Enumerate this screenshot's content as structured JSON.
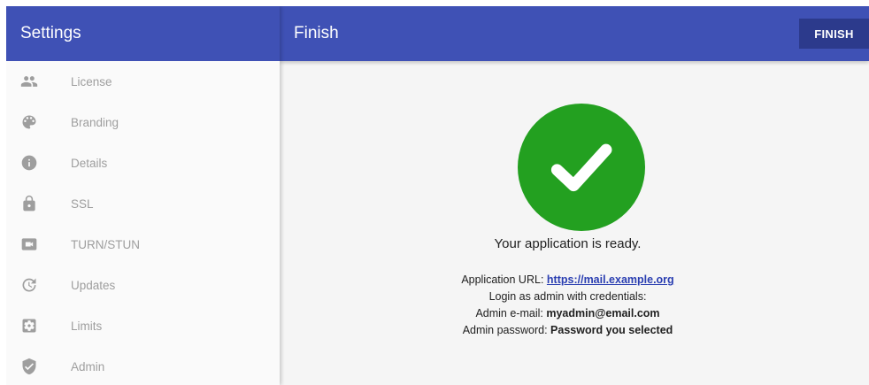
{
  "sidebar": {
    "title": "Settings",
    "items": [
      {
        "label": "License",
        "icon": "people-icon"
      },
      {
        "label": "Branding",
        "icon": "palette-icon"
      },
      {
        "label": "Details",
        "icon": "info-icon"
      },
      {
        "label": "SSL",
        "icon": "lock-icon"
      },
      {
        "label": "TURN/STUN",
        "icon": "videocam-icon"
      },
      {
        "label": "Updates",
        "icon": "update-icon"
      },
      {
        "label": "Limits",
        "icon": "settings-box-icon"
      },
      {
        "label": "Admin",
        "icon": "shield-icon"
      }
    ]
  },
  "header": {
    "title": "Finish",
    "finish_label": "FINISH"
  },
  "main": {
    "ready_text": "Your application is ready.",
    "url_label": "Application URL:",
    "url": "https://mail.example.org",
    "login_text": "Login as admin with credentials:",
    "email_label": "Admin e-mail:",
    "email": "myadmin@email.com",
    "password_label": "Admin password:",
    "password": "Password you selected"
  },
  "colors": {
    "primary": "#3f51b5",
    "button": "#2c3a8c",
    "success": "#23a020",
    "link": "#2a3eb1"
  }
}
